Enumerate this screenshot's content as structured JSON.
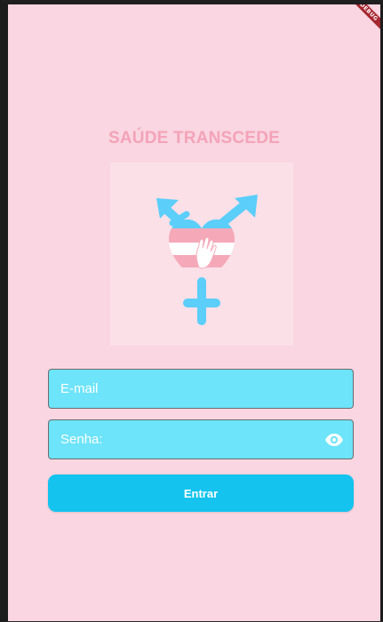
{
  "app": {
    "title": "SAÚDE TRANSCEDE",
    "debug_banner": "DEBUG"
  },
  "logo": {
    "icon": "transgender-heart-logo-icon",
    "colors": {
      "blue": "#5bcefa",
      "pink": "#f5a9b8",
      "white": "#ffffff"
    }
  },
  "login": {
    "email_placeholder": "E-mail",
    "password_placeholder": "Senha:",
    "submit_label": "Entrar",
    "password_toggle_icon": "eye-icon"
  },
  "colors": {
    "background": "#f9d6e1",
    "title": "#f4a3b8",
    "field_fill": "#6de4f9",
    "button_fill": "#14c3ee"
  }
}
